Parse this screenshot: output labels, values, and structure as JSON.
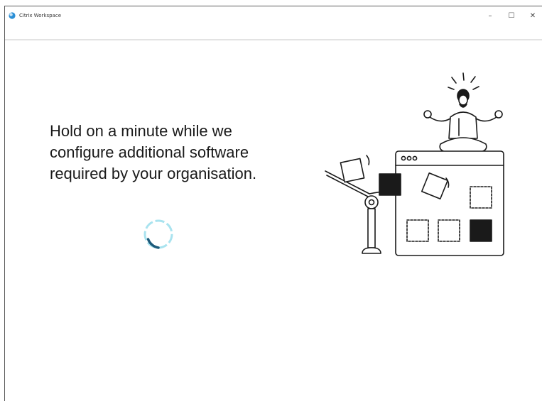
{
  "window": {
    "title": "Citrix Workspace",
    "app_icon": "citrix-globe-icon",
    "controls": {
      "minimize": "–",
      "maximize": "☐",
      "close": "✕"
    }
  },
  "main": {
    "message_lines": [
      "Hold on a minute while we",
      "configure additional software",
      "required by your organisation."
    ],
    "spinner_icon": "loading-spinner",
    "illustration": "meditating-person-on-browser-window-conveyor-illustration"
  },
  "colors": {
    "accent": "#2b8fd6",
    "spinner_dark": "#1c5a7a",
    "spinner_light": "#a9e3ef",
    "text": "#1a1a1a"
  }
}
